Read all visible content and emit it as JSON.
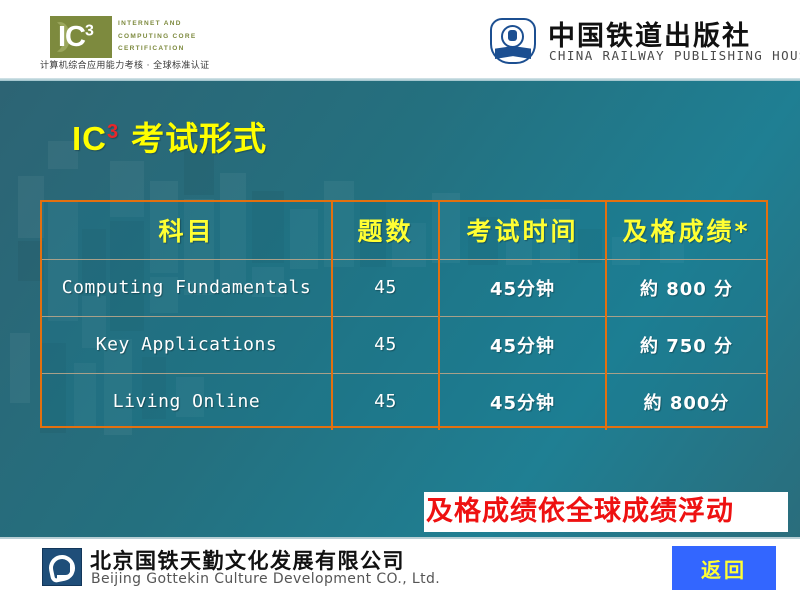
{
  "header": {
    "ic3_logo": {
      "mark_text": "IC",
      "mark_sup": "3",
      "line1": "INTERNET AND",
      "line2": "COMPUTING CORE",
      "line3": "CERTIFICATION",
      "chinese_tagline": "计算机综合应用能力考核 · 全球标准认证",
      "mark_color": "#7d8a3e"
    },
    "publisher_logo": {
      "chinese_name": "中国铁道出版社",
      "english_name": "CHINA RAILWAY PUBLISHING HOUSE",
      "emblem_color": "#1c4f91"
    }
  },
  "slide": {
    "title_ic": "IC",
    "title_sup": "3",
    "title_cn": "考试形式",
    "title_color": "#ffff00",
    "title_sup_color": "#e8262a",
    "background_color": "#24707f"
  },
  "table": {
    "border_color": "#e3700f",
    "header_text_color": "#ffff33",
    "columns": [
      "科目",
      "题数",
      "考试时间",
      "及格成绩*"
    ],
    "rows": [
      {
        "subject": "Computing Fundamentals",
        "count": "45",
        "time": "45分钟",
        "score": "約 800 分"
      },
      {
        "subject": "Key Applications",
        "count": "45",
        "time": "45分钟",
        "score": "約 750 分"
      },
      {
        "subject": "Living Online",
        "count": "45",
        "time": "45分钟",
        "score": "約 800分"
      }
    ]
  },
  "note": {
    "text": "及格成绩依全球成绩浮动",
    "color": "#ee1111"
  },
  "footer": {
    "company_logo": {
      "chinese_name": "北京国铁天勤文化发展有限公司",
      "english_name": "Beijing Gottekin Culture Development CO., Ltd.",
      "mark_color": "#1f4e79"
    },
    "return_button": {
      "label": "返回",
      "background_color": "#3366ff",
      "text_color": "#ffff33"
    }
  }
}
